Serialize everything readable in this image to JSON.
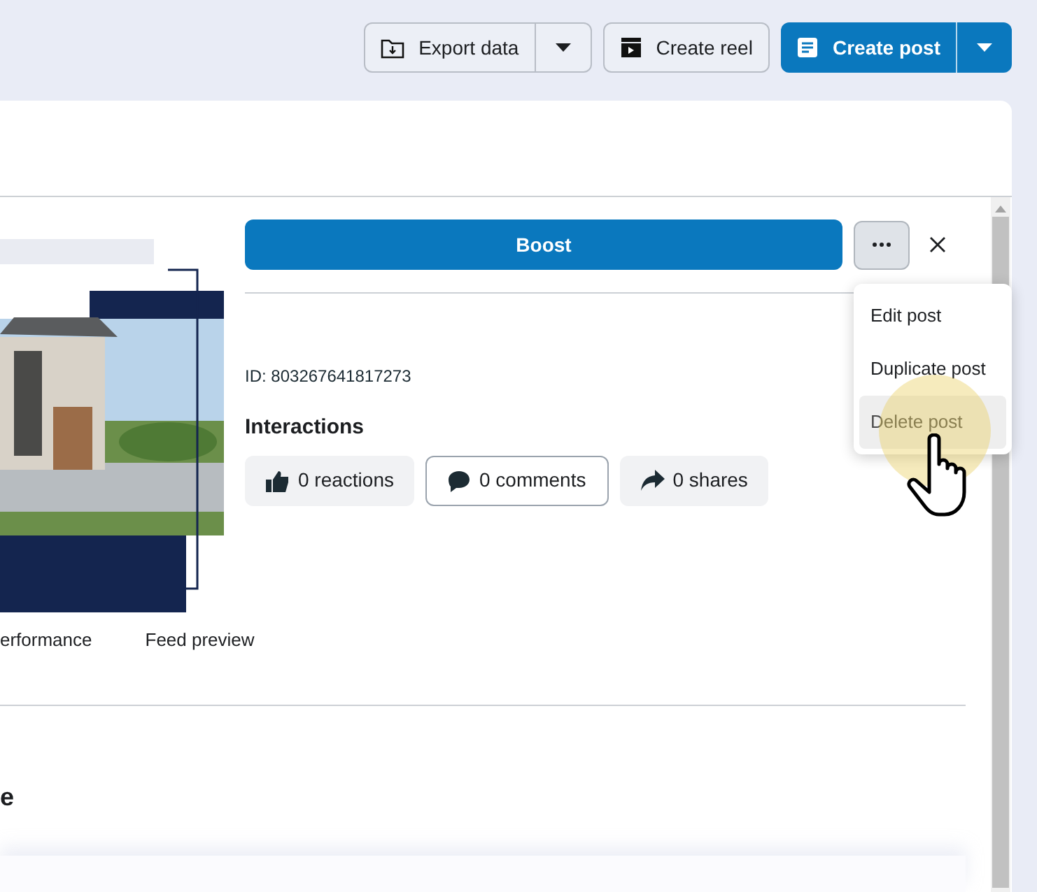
{
  "toolbar": {
    "buttons": [
      {
        "kind": "split",
        "label": "Export data",
        "primary": false
      },
      {
        "kind": "plain",
        "label": "Create reel",
        "primary": false
      },
      {
        "kind": "split",
        "label": "Create post",
        "primary": true
      }
    ]
  },
  "post": {
    "boost_button": "Boost",
    "post_id": "ID: 803267641817273",
    "interactions_title": "Interactions",
    "interactions": [
      {
        "kind": "reactions",
        "label": "0 reactions",
        "selected": false
      },
      {
        "kind": "comments",
        "label": "0 comments",
        "selected": true
      },
      {
        "kind": "shares",
        "label": "0 shares",
        "selected": false
      }
    ],
    "menu": [
      {
        "label": "Edit post",
        "hovered": false
      },
      {
        "label": "Duplicate post",
        "hovered": false
      },
      {
        "label": "Delete post",
        "hovered": true
      }
    ]
  },
  "tabs": [
    {
      "label": "erformance",
      "selected": false
    },
    {
      "label": "Feed preview",
      "selected": false
    }
  ],
  "section_heading": "e"
}
